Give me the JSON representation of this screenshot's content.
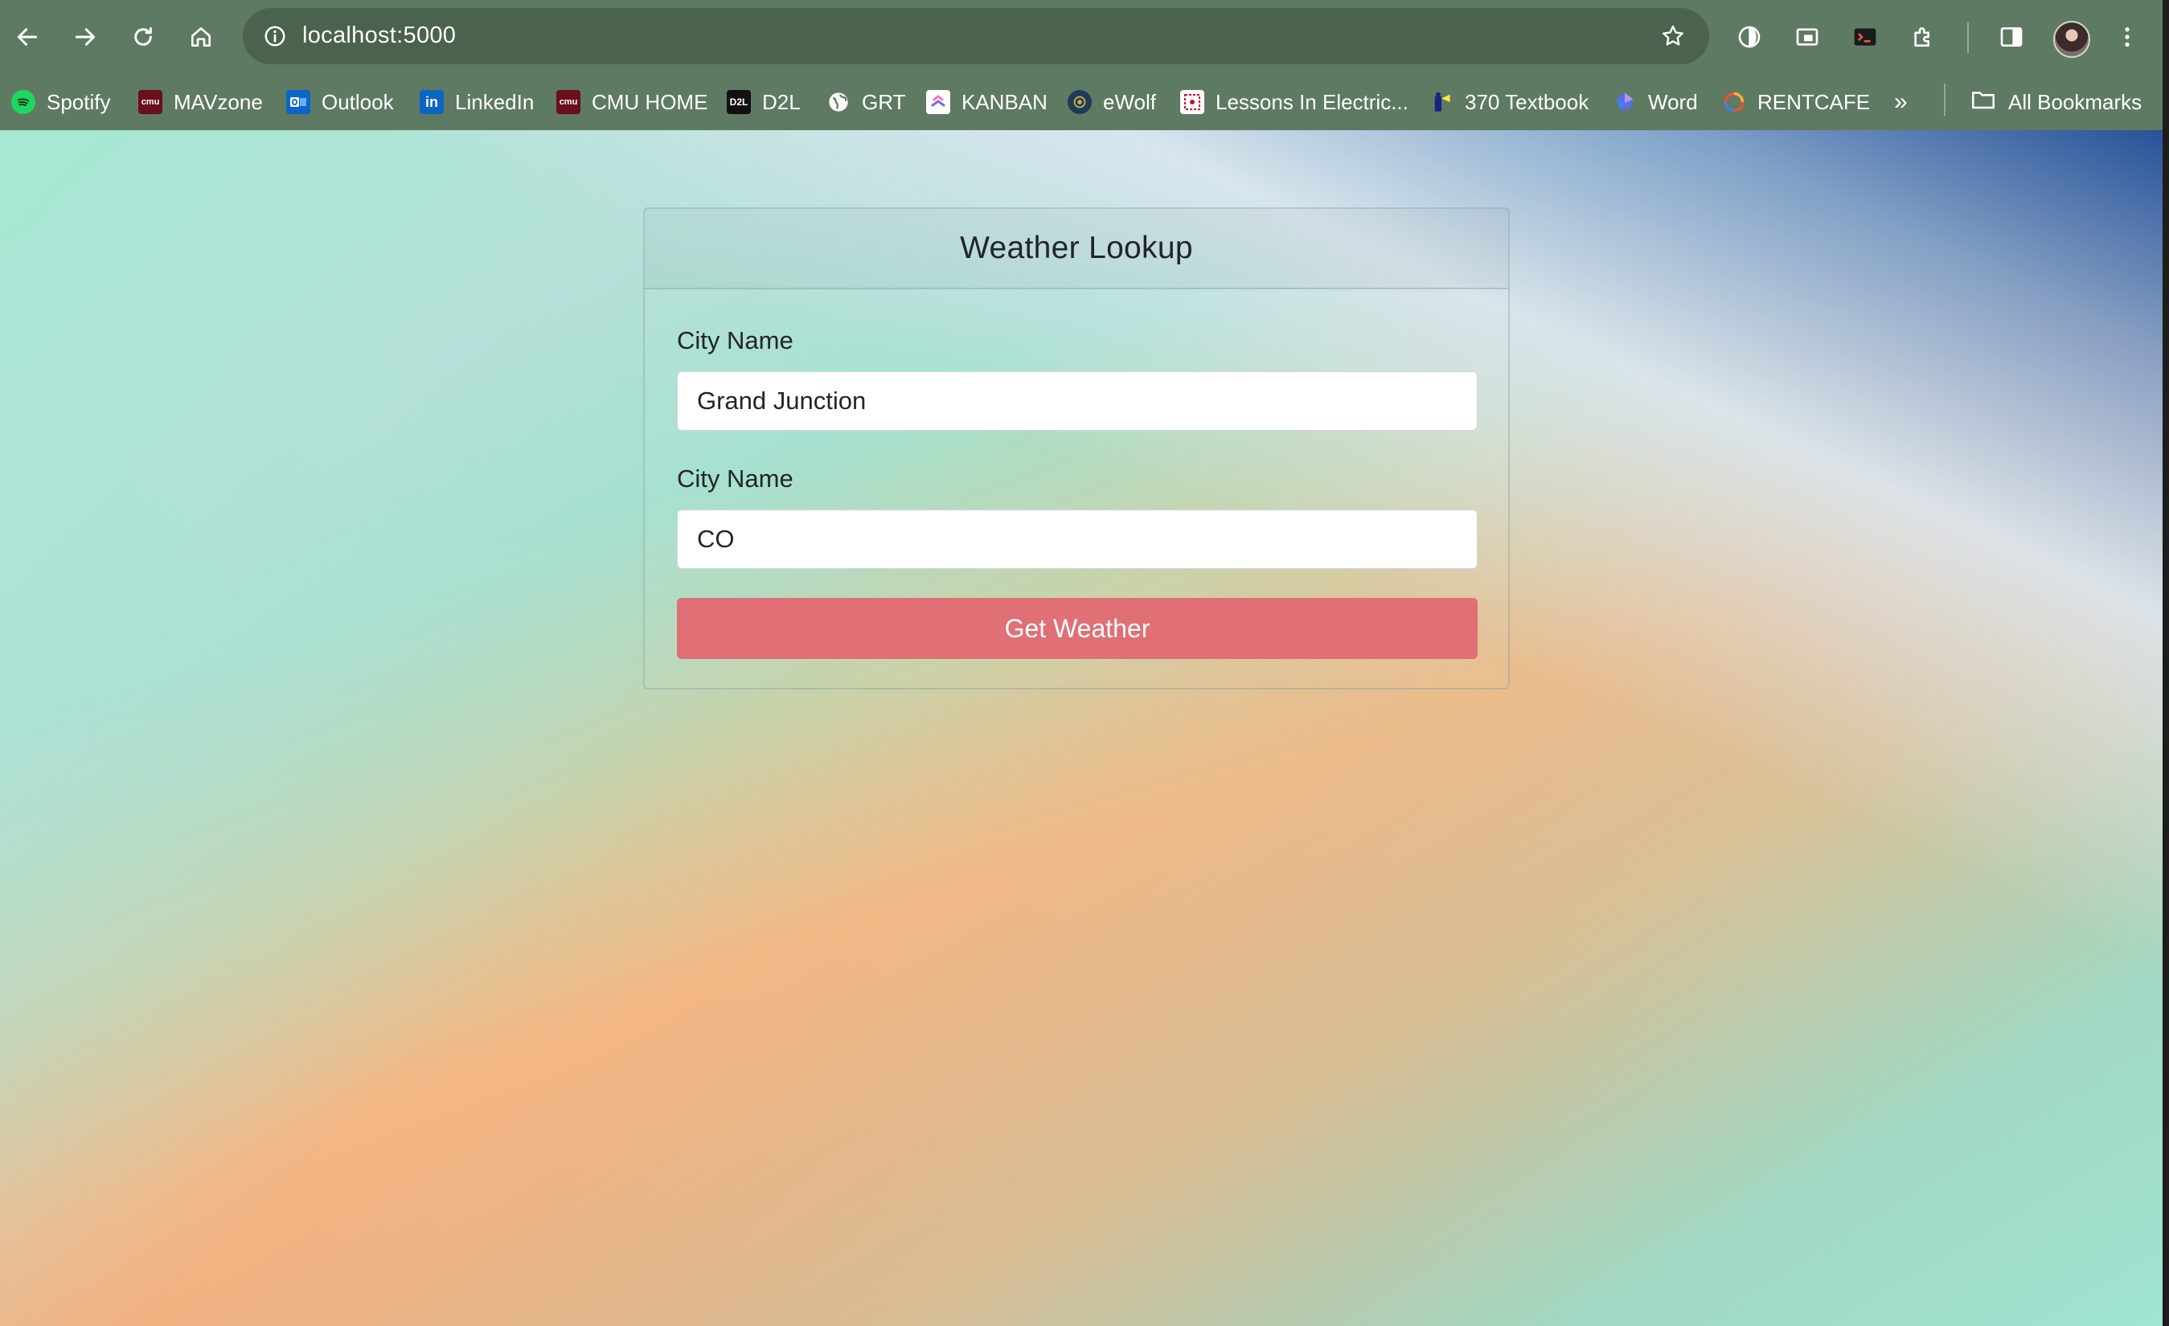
{
  "browser": {
    "url": "localhost:5000",
    "bookmarks": [
      {
        "label": "Spotify",
        "icon": "spotify-icon"
      },
      {
        "label": "MAVzone",
        "icon": "cmu-icon"
      },
      {
        "label": "Outlook",
        "icon": "outlook-icon"
      },
      {
        "label": "LinkedIn",
        "icon": "linkedin-icon"
      },
      {
        "label": "CMU HOME",
        "icon": "cmu-icon"
      },
      {
        "label": "D2L",
        "icon": "d2l-icon"
      },
      {
        "label": "GRT",
        "icon": "globe-icon"
      },
      {
        "label": "KANBAN",
        "icon": "clickup-icon"
      },
      {
        "label": "eWolf",
        "icon": "ewolf-icon"
      },
      {
        "label": "Lessons In Electric...",
        "icon": "lessons-icon"
      },
      {
        "label": "370 Textbook",
        "icon": "textbook-icon"
      },
      {
        "label": "Word",
        "icon": "word-icon"
      },
      {
        "label": "RENTCAFE",
        "icon": "rentcafe-icon"
      }
    ],
    "more_bookmarks": "»",
    "all_bookmarks": "All Bookmarks",
    "favicon_text": {
      "cmu": "cmu",
      "d2l": "D2L",
      "linkedin": "in"
    }
  },
  "card": {
    "title": "Weather Lookup",
    "city_label": "City Name",
    "city_value": "Grand Junction",
    "state_label": "City Name",
    "state_value": "CO",
    "submit_label": "Get Weather"
  },
  "colors": {
    "toolbar": "#5e7a62",
    "button": "#e06f76"
  }
}
